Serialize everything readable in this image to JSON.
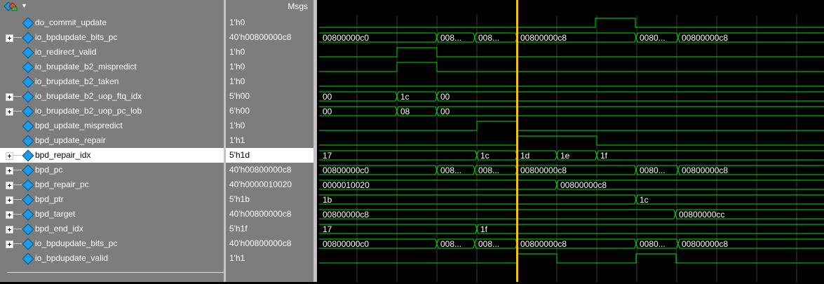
{
  "header": {
    "msgs_label": "Msgs"
  },
  "signals": [
    {
      "name": "do_commit_update",
      "value": "1'h0",
      "expandable": false
    },
    {
      "name": "io_bpdupdate_bits_pc",
      "value": "40'h00800000c8",
      "expandable": true
    },
    {
      "name": "io_redirect_valid",
      "value": "1'h0",
      "expandable": false
    },
    {
      "name": "io_brupdate_b2_mispredict",
      "value": "1'h0",
      "expandable": false
    },
    {
      "name": "io_brupdate_b2_taken",
      "value": "1'h0",
      "expandable": false
    },
    {
      "name": "io_brupdate_b2_uop_ftq_idx",
      "value": "5'h00",
      "expandable": true
    },
    {
      "name": "io_brupdate_b2_uop_pc_lob",
      "value": "6'h00",
      "expandable": true
    },
    {
      "name": "bpd_update_mispredict",
      "value": "1'h0",
      "expandable": false
    },
    {
      "name": "bpd_update_repair",
      "value": "1'h1",
      "expandable": false
    },
    {
      "name": "bpd_repair_idx",
      "value": "5'h1d",
      "expandable": true,
      "selected": true
    },
    {
      "name": "bpd_pc",
      "value": "40'h00800000c8",
      "expandable": true
    },
    {
      "name": "bpd_repair_pc",
      "value": "40'h0000010020",
      "expandable": true
    },
    {
      "name": "bpd_ptr",
      "value": "5'h1b",
      "expandable": true
    },
    {
      "name": "bpd_target",
      "value": "40'h00800000c8",
      "expandable": true
    },
    {
      "name": "bpd_end_idx",
      "value": "5'h1f",
      "expandable": true
    },
    {
      "name": "io_bpdupdate_bits_pc",
      "value": "40'h00800000c8",
      "expandable": true
    },
    {
      "name": "io_bpdupdate_valid",
      "value": "1'h1",
      "expandable": false
    }
  ],
  "colors": {
    "wave": "#00e000",
    "grid": "#3a3a3a",
    "cursor": "#f2c50a",
    "bus_text": "#ffffff"
  },
  "waves": [
    {
      "type": "bit",
      "init": 0,
      "transitions": [
        [
          397,
          1
        ],
        [
          454,
          0
        ]
      ]
    },
    {
      "type": "bus",
      "segments": [
        [
          3,
          "00800000c0"
        ],
        [
          171,
          "008..."
        ],
        [
          225,
          "008..."
        ],
        [
          285,
          "00800000c8"
        ],
        [
          455,
          "0080..."
        ],
        [
          515,
          "00800000c8"
        ]
      ]
    },
    {
      "type": "bit",
      "init": 0,
      "transitions": [
        [
          114,
          1
        ],
        [
          171,
          0
        ]
      ]
    },
    {
      "type": "bit",
      "init": 0,
      "transitions": [
        [
          114,
          1
        ],
        [
          171,
          0
        ]
      ]
    },
    {
      "type": "bit",
      "init": 0,
      "transitions": []
    },
    {
      "type": "bus",
      "segments": [
        [
          3,
          "00"
        ],
        [
          114,
          "1c"
        ],
        [
          171,
          "00"
        ]
      ]
    },
    {
      "type": "bus",
      "segments": [
        [
          3,
          "00"
        ],
        [
          114,
          "08"
        ],
        [
          171,
          "00"
        ]
      ]
    },
    {
      "type": "bit",
      "init": 0,
      "transitions": [
        [
          228,
          1
        ],
        [
          285,
          0
        ]
      ]
    },
    {
      "type": "bit",
      "init": 0,
      "transitions": [
        [
          285,
          1
        ],
        [
          399,
          0
        ]
      ]
    },
    {
      "type": "bus",
      "segments": [
        [
          3,
          "17"
        ],
        [
          228,
          "1c"
        ],
        [
          285,
          "1d"
        ],
        [
          342,
          "1e"
        ],
        [
          399,
          "1f"
        ]
      ]
    },
    {
      "type": "bus",
      "segments": [
        [
          3,
          "00800000c0"
        ],
        [
          171,
          "008..."
        ],
        [
          225,
          "008..."
        ],
        [
          285,
          "00800000c8"
        ],
        [
          455,
          "0080..."
        ],
        [
          515,
          "00800000c8"
        ]
      ]
    },
    {
      "type": "bus",
      "segments": [
        [
          3,
          "0000010020"
        ],
        [
          342,
          "00800000c8"
        ]
      ]
    },
    {
      "type": "bus",
      "segments": [
        [
          3,
          "1b"
        ],
        [
          455,
          "1c"
        ]
      ]
    },
    {
      "type": "bus",
      "segments": [
        [
          3,
          "00800000c8"
        ],
        [
          511,
          "00800000cc"
        ]
      ]
    },
    {
      "type": "bus",
      "segments": [
        [
          3,
          "17"
        ],
        [
          228,
          "1f"
        ]
      ]
    },
    {
      "type": "bus",
      "segments": [
        [
          3,
          "00800000c0"
        ],
        [
          171,
          "008..."
        ],
        [
          225,
          "008..."
        ],
        [
          285,
          "00800000c8"
        ],
        [
          455,
          "0080..."
        ],
        [
          515,
          "00800000c8"
        ]
      ]
    },
    {
      "type": "bit",
      "init": 0,
      "transitions": [
        [
          285,
          1
        ],
        [
          342,
          0
        ],
        [
          455,
          1
        ],
        [
          512,
          0
        ]
      ]
    }
  ]
}
